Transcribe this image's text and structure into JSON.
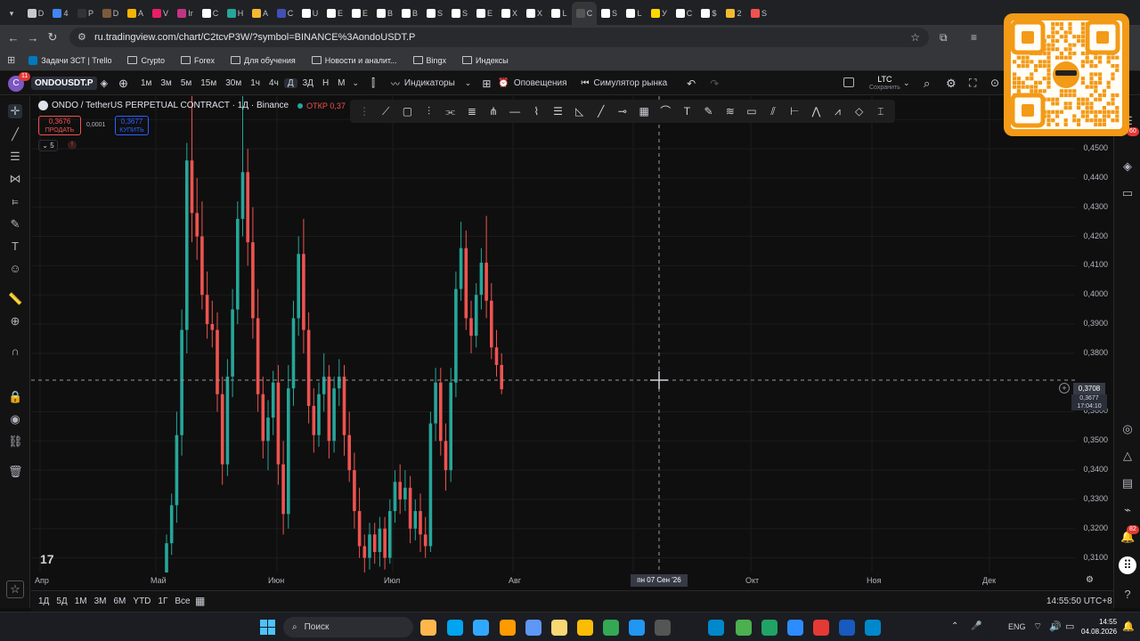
{
  "browser": {
    "tabs": [
      "D",
      "4",
      "P",
      "D",
      "A",
      "V",
      "Ir",
      "C",
      "H",
      "A",
      "C",
      "U",
      "E",
      "E",
      "B",
      "B",
      "S",
      "S",
      "E",
      "X",
      "X",
      "L",
      "C",
      "S",
      "L",
      "У",
      "C",
      "$",
      "2",
      "S"
    ],
    "active_tab_index": 22,
    "url": "ru.tradingview.com/chart/C2tcvP3W/?symbol=BINANCE%3AondoUSDT.P",
    "bookmarks": [
      "Задачи ЗСТ | Trello",
      "Crypto",
      "Forex",
      "Для обучения",
      "Новости и аналит...",
      "Bingx",
      "Индексы"
    ]
  },
  "tv": {
    "avatar_letter": "C",
    "avatar_badge": "11",
    "symbol": "ONDOUSDT.P",
    "timeframes": [
      "1м",
      "3м",
      "5м",
      "15м",
      "30м",
      "1ч",
      "4ч",
      "Д",
      "3Д",
      "Н",
      "М"
    ],
    "selected_timeframe": "Д",
    "indicators_label": "Индикаторы",
    "alerts_label": "Оповещения",
    "replay_label": "Симулятор рынка",
    "layout_name": "LTC",
    "layout_status": "Сохранить",
    "legend_title": "ONDO / TetherUS PERPETUAL CONTRACT · 1Д · Binance",
    "legend_open": "ОТКР 0,37",
    "sell_price": "0,3676",
    "sell_label": "ПРОДАТЬ",
    "spread": "0,0001",
    "buy_price": "0,3677",
    "buy_label": "КУПИТЬ",
    "indicator_count": "5",
    "price_labels": [
      "0,4600",
      "0,4500",
      "0,4400",
      "0,4300",
      "0,4200",
      "0,4100",
      "0,4000",
      "0,3900",
      "0,3800",
      "0,3600",
      "0,3500",
      "0,3400",
      "0,3300",
      "0,3200",
      "0,3100"
    ],
    "crosshair_price": "0,3708",
    "last_price": "0,3677",
    "countdown": "17:04:10",
    "time_labels": [
      "Апр",
      "Май",
      "Июн",
      "Июл",
      "Авг",
      "Окт",
      "Ноя",
      "Дек"
    ],
    "crosshair_date": "пн 07 Сен '26",
    "ranges": [
      "1Д",
      "5Д",
      "1М",
      "3М",
      "6М",
      "YTD",
      "1Г",
      "Все"
    ],
    "clock": "14:55:50 UTC+8",
    "right_badges": [
      "60",
      "82"
    ],
    "logo": "17"
  },
  "taskbar": {
    "search_placeholder": "Поиск",
    "language": "ENG",
    "time": "14:55",
    "date": "04.08.2026"
  },
  "chart_data": {
    "type": "candlestick",
    "symbol": "ONDO / TetherUS PERPETUAL CONTRACT",
    "ylim": [
      0.305,
      0.468
    ],
    "up_color": "#26a69a",
    "down_color": "#ef5350",
    "ohlc": [
      [
        0.3,
        0.318,
        0.297,
        0.315
      ],
      [
        0.315,
        0.332,
        0.311,
        0.328
      ],
      [
        0.328,
        0.36,
        0.322,
        0.352
      ],
      [
        0.352,
        0.395,
        0.345,
        0.388
      ],
      [
        0.388,
        0.452,
        0.38,
        0.446
      ],
      [
        0.446,
        0.478,
        0.418,
        0.428
      ],
      [
        0.428,
        0.44,
        0.412,
        0.42
      ],
      [
        0.42,
        0.432,
        0.395,
        0.4
      ],
      [
        0.4,
        0.408,
        0.385,
        0.39
      ],
      [
        0.39,
        0.398,
        0.382,
        0.388
      ],
      [
        0.388,
        0.394,
        0.36,
        0.366
      ],
      [
        0.366,
        0.372,
        0.335,
        0.342
      ],
      [
        0.342,
        0.378,
        0.338,
        0.372
      ],
      [
        0.372,
        0.402,
        0.365,
        0.395
      ],
      [
        0.395,
        0.432,
        0.39,
        0.426
      ],
      [
        0.426,
        0.478,
        0.42,
        0.442
      ],
      [
        0.442,
        0.45,
        0.41,
        0.418
      ],
      [
        0.418,
        0.43,
        0.385,
        0.392
      ],
      [
        0.392,
        0.402,
        0.36,
        0.366
      ],
      [
        0.366,
        0.372,
        0.344,
        0.35
      ],
      [
        0.35,
        0.364,
        0.34,
        0.358
      ],
      [
        0.358,
        0.374,
        0.352,
        0.37
      ],
      [
        0.37,
        0.376,
        0.335,
        0.342
      ],
      [
        0.342,
        0.35,
        0.318,
        0.325
      ],
      [
        0.325,
        0.376,
        0.32,
        0.368
      ],
      [
        0.368,
        0.398,
        0.362,
        0.392
      ],
      [
        0.392,
        0.42,
        0.386,
        0.414
      ],
      [
        0.414,
        0.426,
        0.38,
        0.388
      ],
      [
        0.388,
        0.394,
        0.356,
        0.362
      ],
      [
        0.362,
        0.368,
        0.346,
        0.352
      ],
      [
        0.352,
        0.37,
        0.348,
        0.366
      ],
      [
        0.366,
        0.38,
        0.36,
        0.372
      ],
      [
        0.372,
        0.376,
        0.344,
        0.35
      ],
      [
        0.35,
        0.372,
        0.346,
        0.368
      ],
      [
        0.368,
        0.378,
        0.362,
        0.372
      ],
      [
        0.372,
        0.376,
        0.345,
        0.352
      ],
      [
        0.352,
        0.36,
        0.336,
        0.34
      ],
      [
        0.34,
        0.346,
        0.32,
        0.326
      ],
      [
        0.326,
        0.334,
        0.31,
        0.314
      ],
      [
        0.314,
        0.318,
        0.305,
        0.31
      ],
      [
        0.31,
        0.322,
        0.306,
        0.318
      ],
      [
        0.318,
        0.322,
        0.308,
        0.312
      ],
      [
        0.312,
        0.324,
        0.307,
        0.32
      ],
      [
        0.32,
        0.324,
        0.306,
        0.31
      ],
      [
        0.31,
        0.33,
        0.308,
        0.326
      ],
      [
        0.326,
        0.34,
        0.322,
        0.336
      ],
      [
        0.336,
        0.342,
        0.325,
        0.33
      ],
      [
        0.33,
        0.34,
        0.326,
        0.334
      ],
      [
        0.334,
        0.338,
        0.315,
        0.32
      ],
      [
        0.32,
        0.33,
        0.316,
        0.326
      ],
      [
        0.326,
        0.332,
        0.312,
        0.318
      ],
      [
        0.318,
        0.324,
        0.31,
        0.314
      ],
      [
        0.314,
        0.36,
        0.312,
        0.356
      ],
      [
        0.356,
        0.375,
        0.35,
        0.37
      ],
      [
        0.37,
        0.375,
        0.345,
        0.35
      ],
      [
        0.35,
        0.356,
        0.333,
        0.34
      ],
      [
        0.34,
        0.375,
        0.336,
        0.37
      ],
      [
        0.37,
        0.408,
        0.365,
        0.402
      ],
      [
        0.402,
        0.425,
        0.398,
        0.416
      ],
      [
        0.416,
        0.422,
        0.388,
        0.392
      ],
      [
        0.392,
        0.398,
        0.38,
        0.386
      ],
      [
        0.386,
        0.404,
        0.382,
        0.4
      ],
      [
        0.4,
        0.416,
        0.395,
        0.411
      ],
      [
        0.411,
        0.427,
        0.392,
        0.398
      ],
      [
        0.398,
        0.404,
        0.378,
        0.382
      ],
      [
        0.382,
        0.388,
        0.372,
        0.376
      ],
      [
        0.376,
        0.38,
        0.366,
        0.3677
      ]
    ]
  }
}
